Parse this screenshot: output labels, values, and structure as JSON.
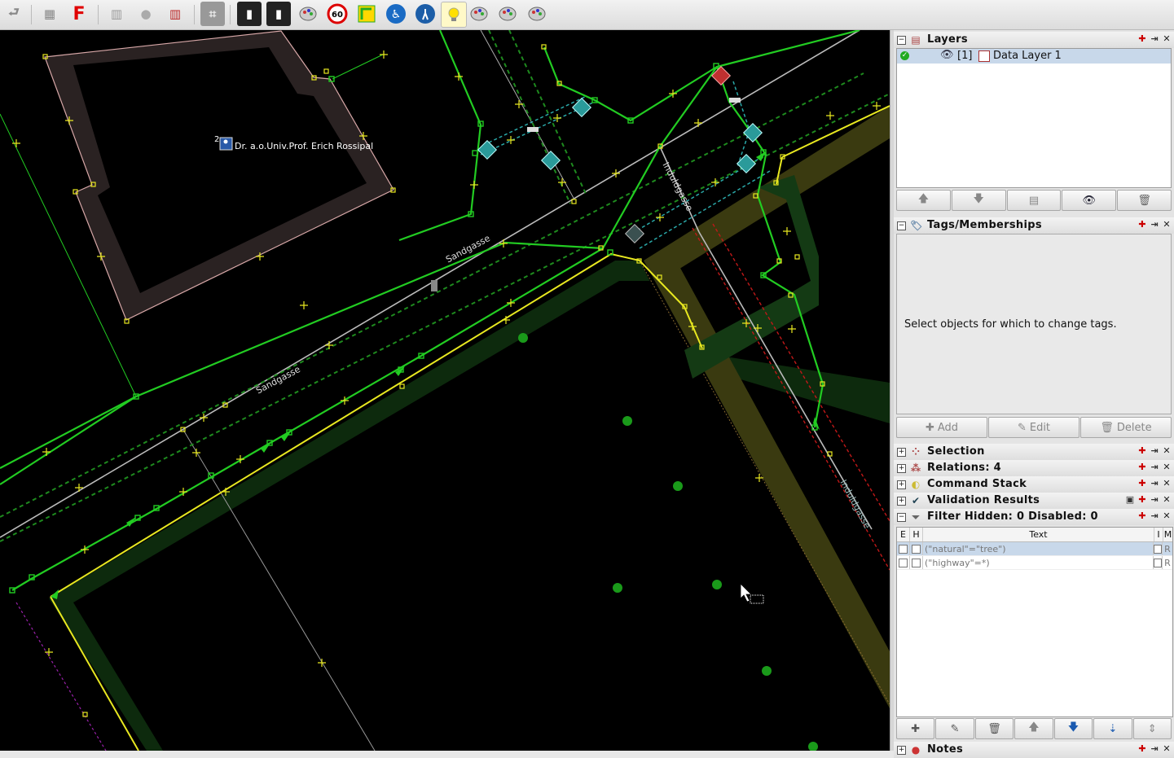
{
  "toolbar": {
    "buttons": [
      {
        "name": "undo-icon",
        "glyph": "⮐"
      },
      {
        "name": "shop-icon",
        "glyph": "▦"
      },
      {
        "name": "red-f-icon",
        "glyph": "F"
      },
      {
        "name": "barrier-icon",
        "glyph": "▥"
      },
      {
        "name": "globe-icon",
        "glyph": "●"
      },
      {
        "name": "barcode-icon",
        "glyph": "▥"
      },
      {
        "name": "crossing-icon",
        "glyph": "⌗"
      },
      {
        "name": "railway-icon",
        "glyph": "▮"
      },
      {
        "name": "railway-2-icon",
        "glyph": "▮"
      },
      {
        "name": "palette-icon",
        "glyph": "🎨"
      },
      {
        "name": "speed-limit-icon",
        "glyph": "60"
      },
      {
        "name": "route-icon",
        "glyph": "▣"
      },
      {
        "name": "wheelchair-icon",
        "glyph": "♿"
      },
      {
        "name": "hiking-icon",
        "glyph": "⚲"
      },
      {
        "name": "lightbulb-icon",
        "glyph": "💡"
      },
      {
        "name": "palette-2-icon",
        "glyph": "🎨"
      },
      {
        "name": "palette-3-icon",
        "glyph": "🎨"
      },
      {
        "name": "palette-4-icon",
        "glyph": "🎨"
      }
    ]
  },
  "map": {
    "poi_label": "Dr. a.o.Univ.Prof. Erich Rossipal",
    "poi_number": "2",
    "street_labels": [
      "Sandgasse",
      "Sandgasse",
      "Induldgasse",
      "Induldgasse"
    ]
  },
  "layers": {
    "title": "Layers",
    "row_index": "[1]",
    "row_name": "Data Layer 1",
    "buttons": [
      "move-up",
      "move-down",
      "merge",
      "toggle-visibility",
      "delete"
    ]
  },
  "tags": {
    "title": "Tags/Memberships",
    "empty_message": "Select objects for which to change tags.",
    "add": "Add",
    "edit": "Edit",
    "delete": "Delete"
  },
  "panels": {
    "selection": "Selection",
    "relations": "Relations: 4",
    "command_stack": "Command Stack",
    "validation": "Validation Results",
    "filter": "Filter Hidden: 0 Disabled: 0",
    "notes": "Notes"
  },
  "filter_table": {
    "headers": [
      "E",
      "H",
      "Text",
      "I",
      "M"
    ],
    "rows": [
      {
        "text": "(\"natural\"=\"tree\")",
        "m": "R"
      },
      {
        "text": "(\"highway\"=*)",
        "m": "R"
      }
    ]
  }
}
